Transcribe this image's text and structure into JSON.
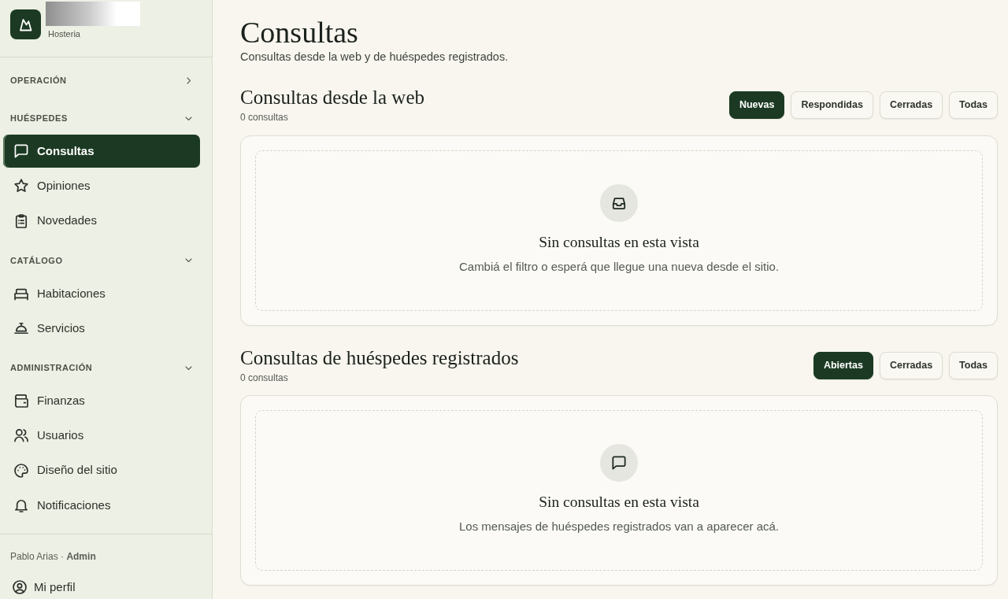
{
  "sidebar": {
    "brand": {
      "subtitle": "Hosteria"
    },
    "groups": [
      {
        "label": "OPERACIÓN",
        "expanded": false
      },
      {
        "label": "HUÉSPEDES",
        "expanded": true,
        "items": [
          {
            "label": "Consultas",
            "selected": true
          },
          {
            "label": "Opiniones",
            "selected": false
          },
          {
            "label": "Novedades",
            "selected": false
          }
        ]
      },
      {
        "label": "CATÁLOGO",
        "expanded": true,
        "items": [
          {
            "label": "Habitaciones",
            "selected": false
          },
          {
            "label": "Servicios",
            "selected": false
          }
        ]
      },
      {
        "label": "ADMINISTRACIÓN",
        "expanded": true,
        "items": [
          {
            "label": "Finanzas",
            "selected": false
          },
          {
            "label": "Usuarios",
            "selected": false
          },
          {
            "label": "Diseño del sitio",
            "selected": false
          },
          {
            "label": "Notificaciones",
            "selected": false
          }
        ]
      }
    ],
    "user": "Pablo Arias · **Admin**",
    "profile_link": "Mi perfil"
  },
  "page": {
    "title": "Consultas",
    "subtitle": "Consultas desde la web y de huéspedes registrados."
  },
  "sections": [
    {
      "title": "Consultas desde la web",
      "count": "0 consultas",
      "filters": [
        {
          "label": "Nuevas",
          "selected": true
        },
        {
          "label": "Respondidas",
          "selected": false
        },
        {
          "label": "Cerradas",
          "selected": false
        },
        {
          "label": "Todas",
          "selected": false
        }
      ],
      "empty_state": {
        "title": "Sin consultas en esta vista",
        "message": "Cambiá el filtro o esperá que llegue una nueva desde el sitio."
      }
    },
    {
      "title": "Consultas de huéspedes registrados",
      "count": "0 consultas",
      "filters": [
        {
          "label": "Abiertas",
          "selected": true
        },
        {
          "label": "Cerradas",
          "selected": false
        },
        {
          "label": "Todas",
          "selected": false
        }
      ],
      "empty_state": {
        "title": "Sin consultas en esta vista",
        "message": "Los mensajes de huéspedes registrados van a aparecer acá."
      }
    }
  ]
}
